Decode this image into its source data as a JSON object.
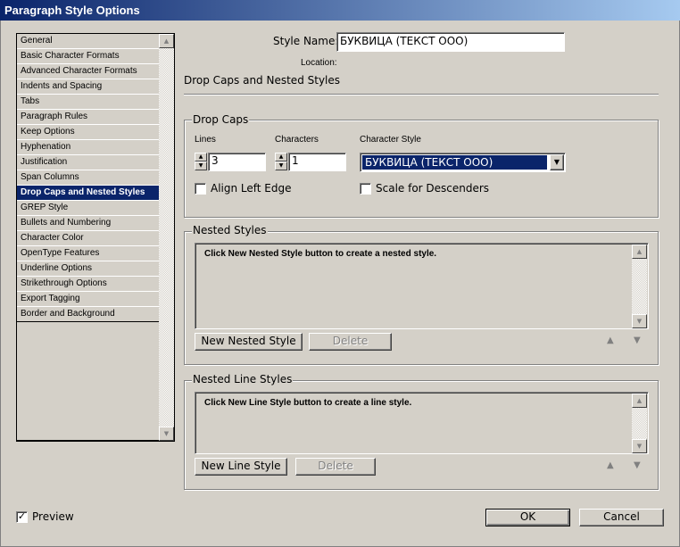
{
  "title": "Paragraph Style Options",
  "sidebar": {
    "items": [
      "General",
      "Basic Character Formats",
      "Advanced Character Formats",
      "Indents and Spacing",
      "Tabs",
      "Paragraph Rules",
      "Keep Options",
      "Hyphenation",
      "Justification",
      "Span Columns",
      "Drop Caps and Nested Styles",
      "GREP Style",
      "Bullets and Numbering",
      "Character Color",
      "OpenType Features",
      "Underline Options",
      "Strikethrough Options",
      "Export Tagging",
      "Border and Background"
    ],
    "selected": "Drop Caps and Nested Styles"
  },
  "style_name": {
    "label": "Style Name:",
    "value": "БУКВИЦА (ТЕКСТ ООО)"
  },
  "location_label": "Location:",
  "section_title": "Drop Caps and Nested Styles",
  "drop_caps": {
    "legend": "Drop Caps",
    "lines_label": "Lines",
    "lines_value": "3",
    "characters_label": "Characters",
    "characters_value": "1",
    "char_style_label": "Character Style",
    "char_style_value": "БУКВИЦА (ТЕКСТ ООО)",
    "align_left_edge": "Align Left Edge",
    "scale_descenders": "Scale for Descenders"
  },
  "nested_styles": {
    "legend": "Nested Styles",
    "hint": "Click New Nested Style button to create a nested style.",
    "new_button": "New Nested Style",
    "delete_button": "Delete"
  },
  "nested_line_styles": {
    "legend": "Nested Line Styles",
    "hint": "Click New Line Style button to create a line style.",
    "new_button": "New Line Style",
    "delete_button": "Delete"
  },
  "footer": {
    "preview": "Preview",
    "preview_checked": true,
    "ok": "OK",
    "cancel": "Cancel"
  },
  "colors": {
    "selection": "#0a246a",
    "background": "#d4d0c8"
  }
}
